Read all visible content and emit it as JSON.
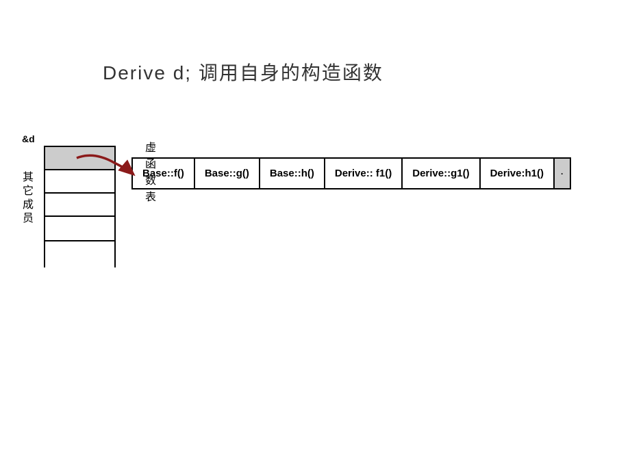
{
  "title": "Derive d;  调用自身的构造函数",
  "addr_label": "&d",
  "member_label": "其它成员",
  "vtable_label": "虚函数表",
  "vtable": {
    "cells": [
      "Base::f()",
      "Base::g()",
      "Base::h()",
      "Derive:: f1()",
      "Derive::g1()",
      "Derive:h1()"
    ],
    "terminator": "·"
  }
}
